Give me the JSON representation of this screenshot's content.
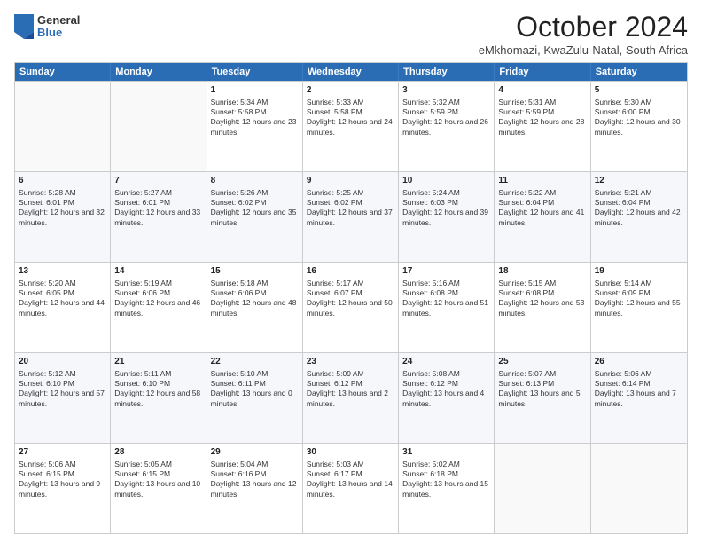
{
  "header": {
    "logo": {
      "general": "General",
      "blue": "Blue"
    },
    "title": "October 2024",
    "location": "eMkhomazi, KwaZulu-Natal, South Africa"
  },
  "calendar": {
    "weekdays": [
      "Sunday",
      "Monday",
      "Tuesday",
      "Wednesday",
      "Thursday",
      "Friday",
      "Saturday"
    ],
    "rows": [
      [
        {
          "day": "",
          "sunrise": "",
          "sunset": "",
          "daylight": "",
          "empty": true
        },
        {
          "day": "",
          "sunrise": "",
          "sunset": "",
          "daylight": "",
          "empty": true
        },
        {
          "day": "1",
          "sunrise": "Sunrise: 5:34 AM",
          "sunset": "Sunset: 5:58 PM",
          "daylight": "Daylight: 12 hours and 23 minutes."
        },
        {
          "day": "2",
          "sunrise": "Sunrise: 5:33 AM",
          "sunset": "Sunset: 5:58 PM",
          "daylight": "Daylight: 12 hours and 24 minutes."
        },
        {
          "day": "3",
          "sunrise": "Sunrise: 5:32 AM",
          "sunset": "Sunset: 5:59 PM",
          "daylight": "Daylight: 12 hours and 26 minutes."
        },
        {
          "day": "4",
          "sunrise": "Sunrise: 5:31 AM",
          "sunset": "Sunset: 5:59 PM",
          "daylight": "Daylight: 12 hours and 28 minutes."
        },
        {
          "day": "5",
          "sunrise": "Sunrise: 5:30 AM",
          "sunset": "Sunset: 6:00 PM",
          "daylight": "Daylight: 12 hours and 30 minutes."
        }
      ],
      [
        {
          "day": "6",
          "sunrise": "Sunrise: 5:28 AM",
          "sunset": "Sunset: 6:01 PM",
          "daylight": "Daylight: 12 hours and 32 minutes."
        },
        {
          "day": "7",
          "sunrise": "Sunrise: 5:27 AM",
          "sunset": "Sunset: 6:01 PM",
          "daylight": "Daylight: 12 hours and 33 minutes."
        },
        {
          "day": "8",
          "sunrise": "Sunrise: 5:26 AM",
          "sunset": "Sunset: 6:02 PM",
          "daylight": "Daylight: 12 hours and 35 minutes."
        },
        {
          "day": "9",
          "sunrise": "Sunrise: 5:25 AM",
          "sunset": "Sunset: 6:02 PM",
          "daylight": "Daylight: 12 hours and 37 minutes."
        },
        {
          "day": "10",
          "sunrise": "Sunrise: 5:24 AM",
          "sunset": "Sunset: 6:03 PM",
          "daylight": "Daylight: 12 hours and 39 minutes."
        },
        {
          "day": "11",
          "sunrise": "Sunrise: 5:22 AM",
          "sunset": "Sunset: 6:04 PM",
          "daylight": "Daylight: 12 hours and 41 minutes."
        },
        {
          "day": "12",
          "sunrise": "Sunrise: 5:21 AM",
          "sunset": "Sunset: 6:04 PM",
          "daylight": "Daylight: 12 hours and 42 minutes."
        }
      ],
      [
        {
          "day": "13",
          "sunrise": "Sunrise: 5:20 AM",
          "sunset": "Sunset: 6:05 PM",
          "daylight": "Daylight: 12 hours and 44 minutes."
        },
        {
          "day": "14",
          "sunrise": "Sunrise: 5:19 AM",
          "sunset": "Sunset: 6:06 PM",
          "daylight": "Daylight: 12 hours and 46 minutes."
        },
        {
          "day": "15",
          "sunrise": "Sunrise: 5:18 AM",
          "sunset": "Sunset: 6:06 PM",
          "daylight": "Daylight: 12 hours and 48 minutes."
        },
        {
          "day": "16",
          "sunrise": "Sunrise: 5:17 AM",
          "sunset": "Sunset: 6:07 PM",
          "daylight": "Daylight: 12 hours and 50 minutes."
        },
        {
          "day": "17",
          "sunrise": "Sunrise: 5:16 AM",
          "sunset": "Sunset: 6:08 PM",
          "daylight": "Daylight: 12 hours and 51 minutes."
        },
        {
          "day": "18",
          "sunrise": "Sunrise: 5:15 AM",
          "sunset": "Sunset: 6:08 PM",
          "daylight": "Daylight: 12 hours and 53 minutes."
        },
        {
          "day": "19",
          "sunrise": "Sunrise: 5:14 AM",
          "sunset": "Sunset: 6:09 PM",
          "daylight": "Daylight: 12 hours and 55 minutes."
        }
      ],
      [
        {
          "day": "20",
          "sunrise": "Sunrise: 5:12 AM",
          "sunset": "Sunset: 6:10 PM",
          "daylight": "Daylight: 12 hours and 57 minutes."
        },
        {
          "day": "21",
          "sunrise": "Sunrise: 5:11 AM",
          "sunset": "Sunset: 6:10 PM",
          "daylight": "Daylight: 12 hours and 58 minutes."
        },
        {
          "day": "22",
          "sunrise": "Sunrise: 5:10 AM",
          "sunset": "Sunset: 6:11 PM",
          "daylight": "Daylight: 13 hours and 0 minutes."
        },
        {
          "day": "23",
          "sunrise": "Sunrise: 5:09 AM",
          "sunset": "Sunset: 6:12 PM",
          "daylight": "Daylight: 13 hours and 2 minutes."
        },
        {
          "day": "24",
          "sunrise": "Sunrise: 5:08 AM",
          "sunset": "Sunset: 6:12 PM",
          "daylight": "Daylight: 13 hours and 4 minutes."
        },
        {
          "day": "25",
          "sunrise": "Sunrise: 5:07 AM",
          "sunset": "Sunset: 6:13 PM",
          "daylight": "Daylight: 13 hours and 5 minutes."
        },
        {
          "day": "26",
          "sunrise": "Sunrise: 5:06 AM",
          "sunset": "Sunset: 6:14 PM",
          "daylight": "Daylight: 13 hours and 7 minutes."
        }
      ],
      [
        {
          "day": "27",
          "sunrise": "Sunrise: 5:06 AM",
          "sunset": "Sunset: 6:15 PM",
          "daylight": "Daylight: 13 hours and 9 minutes."
        },
        {
          "day": "28",
          "sunrise": "Sunrise: 5:05 AM",
          "sunset": "Sunset: 6:15 PM",
          "daylight": "Daylight: 13 hours and 10 minutes."
        },
        {
          "day": "29",
          "sunrise": "Sunrise: 5:04 AM",
          "sunset": "Sunset: 6:16 PM",
          "daylight": "Daylight: 13 hours and 12 minutes."
        },
        {
          "day": "30",
          "sunrise": "Sunrise: 5:03 AM",
          "sunset": "Sunset: 6:17 PM",
          "daylight": "Daylight: 13 hours and 14 minutes."
        },
        {
          "day": "31",
          "sunrise": "Sunrise: 5:02 AM",
          "sunset": "Sunset: 6:18 PM",
          "daylight": "Daylight: 13 hours and 15 minutes."
        },
        {
          "day": "",
          "sunrise": "",
          "sunset": "",
          "daylight": "",
          "empty": true
        },
        {
          "day": "",
          "sunrise": "",
          "sunset": "",
          "daylight": "",
          "empty": true
        }
      ]
    ]
  }
}
